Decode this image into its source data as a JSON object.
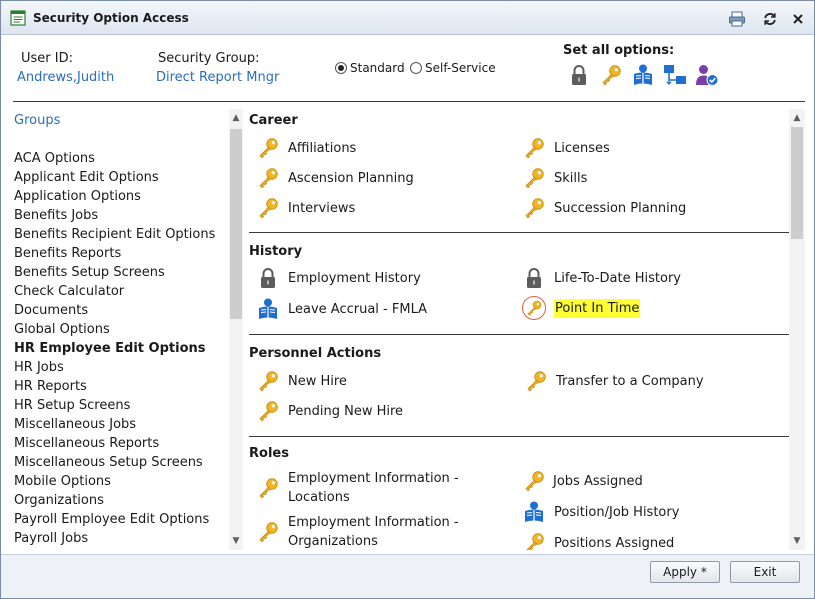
{
  "window": {
    "title": "Security Option Access"
  },
  "titlebar": {
    "icons": [
      "form-icon",
      "print-icon",
      "refresh-icon",
      "close-icon"
    ]
  },
  "header": {
    "user_id_label": "User ID:",
    "user_id_value": "Andrews,Judith",
    "security_group_label": "Security Group:",
    "security_group_value": "Direct Report Mngr",
    "mode_options": [
      {
        "label": "Standard",
        "selected": true
      },
      {
        "label": "Self-Service",
        "selected": false
      }
    ],
    "set_all_label": "Set all options:",
    "set_all_icons": [
      "lock-icon",
      "key-icon",
      "reader-icon",
      "hierarchy-icon",
      "user-check-icon"
    ]
  },
  "groups": {
    "title": "Groups",
    "items": [
      "ACA Options",
      "Applicant Edit Options",
      "Application Options",
      "Benefits Jobs",
      "Benefits Recipient Edit Options",
      "Benefits Reports",
      "Benefits Setup Screens",
      "Check Calculator",
      "Documents",
      "Global Options",
      "HR Employee Edit Options",
      "HR Jobs",
      "HR Reports",
      "HR Setup Screens",
      "Miscellaneous Jobs",
      "Miscellaneous Reports",
      "Miscellaneous Setup Screens",
      "Mobile Options",
      "Organizations",
      "Payroll Employee Edit Options",
      "Payroll Jobs"
    ],
    "selected": "HR Employee Edit Options"
  },
  "sections": {
    "career": {
      "title": "Career",
      "items": [
        {
          "label": "Affiliations",
          "icon": "key-icon"
        },
        {
          "label": "Licenses",
          "icon": "key-icon"
        },
        {
          "label": "Ascension Planning",
          "icon": "key-icon"
        },
        {
          "label": "Skills",
          "icon": "key-icon"
        },
        {
          "label": "Interviews",
          "icon": "key-icon"
        },
        {
          "label": "Succession Planning",
          "icon": "key-icon"
        }
      ]
    },
    "history": {
      "title": "History",
      "items": [
        {
          "label": "Employment History",
          "icon": "lock-icon"
        },
        {
          "label": "Life-To-Date History",
          "icon": "lock-icon"
        },
        {
          "label": "Leave Accrual - FMLA",
          "icon": "reader-icon"
        },
        {
          "label": "Point In Time",
          "icon": "key-icon",
          "highlighted": true
        }
      ]
    },
    "personnel": {
      "title": "Personnel Actions",
      "items": [
        {
          "label": "New Hire",
          "icon": "key-icon"
        },
        {
          "label": "Transfer to a Company",
          "icon": "key-icon"
        },
        {
          "label": "Pending New Hire",
          "icon": "key-icon"
        }
      ]
    },
    "roles": {
      "title": "Roles",
      "items": [
        {
          "line1": "Employment Information -",
          "line2": "Locations",
          "icon": "key-icon"
        },
        {
          "label": "Jobs Assigned",
          "icon": "key-icon"
        },
        {
          "line1": "Employment Information -",
          "line2": "Organizations",
          "icon": "key-icon"
        },
        {
          "label": "Position/Job History",
          "icon": "reader-icon"
        },
        {
          "label": "Positions Assigned",
          "icon": "key-icon"
        }
      ]
    }
  },
  "footer": {
    "apply_label": "Apply *",
    "exit_label": "Exit"
  },
  "colors": {
    "key": "#f0b526",
    "reader": "#1f6fd0",
    "lock": "#5c5c5c",
    "link": "#2a6ebb",
    "highlight": "#ffff33"
  }
}
